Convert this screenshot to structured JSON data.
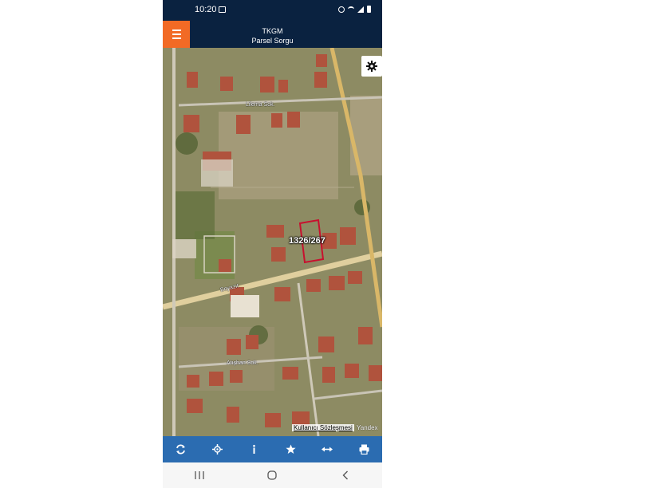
{
  "status_bar": {
    "time": "10:20",
    "icons": [
      "image-icon",
      "alarm-icon",
      "wifi-icon",
      "signal-icon",
      "battery-icon"
    ]
  },
  "app_bar": {
    "title": "TKGM",
    "subtitle": "Parsel Sorgu",
    "menu_icon": "hamburger-menu-icon",
    "accent_color": "#f26a25",
    "background_color": "#0a2240"
  },
  "map": {
    "parcel_label": "1326/267",
    "parcel_outline_color": "#c8102e",
    "streets": [
      "Lilema Sok.",
      "Boyazıt",
      "Atışhan Sok."
    ],
    "attribution": {
      "link_text": "Kullanıcı Sözleşmesi",
      "brand": "Yandex"
    },
    "settings_icon": "gear-icon"
  },
  "toolbar": {
    "background_color": "#2b6cb1",
    "items": [
      {
        "name": "refresh",
        "icon": "refresh-icon"
      },
      {
        "name": "locate",
        "icon": "crosshair-icon"
      },
      {
        "name": "info",
        "icon": "info-icon"
      },
      {
        "name": "favorites",
        "icon": "star-icon"
      },
      {
        "name": "measure",
        "icon": "measure-arrows-icon"
      },
      {
        "name": "print",
        "icon": "printer-icon"
      }
    ]
  },
  "nav_bar": {
    "items": [
      {
        "name": "recents",
        "icon": "recents-icon"
      },
      {
        "name": "home",
        "icon": "home-icon"
      },
      {
        "name": "back",
        "icon": "back-icon"
      }
    ]
  }
}
